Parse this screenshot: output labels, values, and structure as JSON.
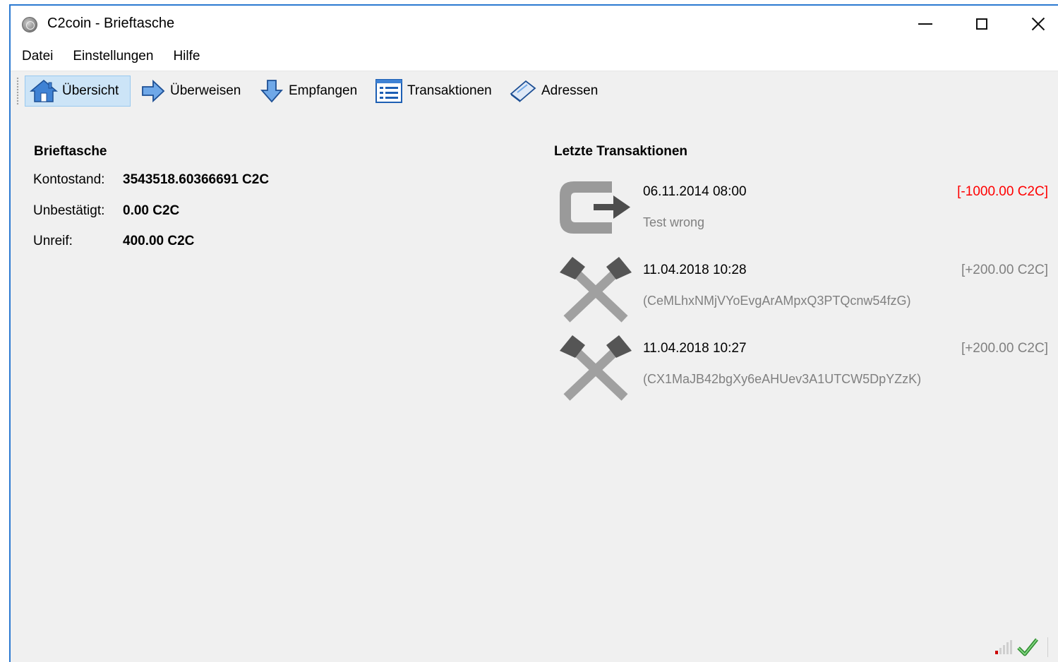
{
  "window": {
    "title": "C2coin - Brieftasche"
  },
  "menu": {
    "items": [
      "Datei",
      "Einstellungen",
      "Hilfe"
    ]
  },
  "toolbar": {
    "overview": "Übersicht",
    "send": "Überweisen",
    "receive": "Empfangen",
    "transactions": "Transaktionen",
    "addresses": "Adressen"
  },
  "wallet": {
    "title": "Brieftasche",
    "balance_label": "Kontostand:",
    "balance_value": "3543518.60366691 C2C",
    "unconfirmed_label": "Unbestätigt:",
    "unconfirmed_value": "0.00 C2C",
    "immature_label": "Unreif:",
    "immature_value": "400.00 C2C"
  },
  "recent": {
    "title": "Letzte Transaktionen",
    "transactions": [
      {
        "type": "sent",
        "date": "06.11.2014 08:00",
        "label": "Test wrong",
        "amount": "[-1000.00 C2C]"
      },
      {
        "type": "mined",
        "date": "11.04.2018 10:28",
        "label": "(CeMLhxNMjVYoEvgArAMpxQ3PTQcnw54fzG)",
        "amount": "[+200.00 C2C]"
      },
      {
        "type": "mined",
        "date": "11.04.2018 10:27",
        "label": "(CX1MaJB42bgXy6eAHUev3A1UTCW5DpYZzK)",
        "amount": "[+200.00 C2C]"
      }
    ]
  },
  "colors": {
    "accent": "#2b79d1",
    "negative": "#ff0000",
    "muted": "#808080",
    "active_tool_bg": "#cce4f7"
  },
  "icons": {
    "app": "coin-icon",
    "overview": "home-icon",
    "send": "arrow-right-icon",
    "receive": "arrow-down-icon",
    "transactions": "list-icon",
    "addresses": "address-book-icon",
    "tx_sent": "tx-sent-icon",
    "tx_mined": "tx-mined-icon",
    "network": "network-signal-icon",
    "synced": "checkmark-icon"
  }
}
